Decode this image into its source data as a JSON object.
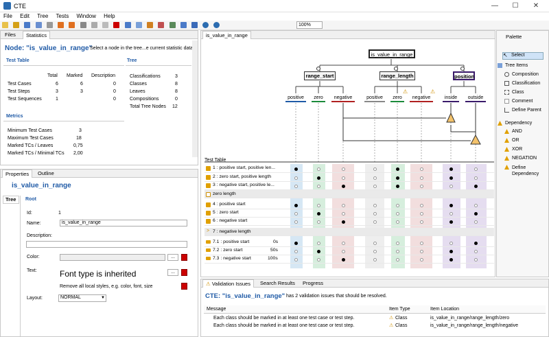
{
  "window": {
    "title": "CTE"
  },
  "menu": [
    "File",
    "Edit",
    "Tree",
    "Tests",
    "Window",
    "Help"
  ],
  "zoom": "100%",
  "left_tabs": {
    "files": "Files",
    "statistics": "Statistics"
  },
  "stats": {
    "node_title": "Node: \"is_value_in_range\"",
    "hint": "Select a node in the tree...e current statistic data.",
    "test_table_header": "Test Table",
    "col_total": "Total",
    "col_marked": "Marked",
    "col_description": "Description",
    "rows": [
      {
        "label": "Test Cases",
        "total": "6",
        "marked": "6",
        "desc": "0"
      },
      {
        "label": "Test Steps",
        "total": "3",
        "marked": "3",
        "desc": "0"
      },
      {
        "label": "Test Sequences",
        "total": "1",
        "marked": "",
        "desc": "0"
      }
    ],
    "tree_header": "Tree",
    "tree_rows": [
      {
        "label": "Classifications",
        "value": "3"
      },
      {
        "label": "Classes",
        "value": "8"
      },
      {
        "label": "Leaves",
        "value": "8"
      },
      {
        "label": "Compositions",
        "value": "0"
      },
      {
        "label": "Total Tree Nodes",
        "value": "12"
      }
    ],
    "metrics_header": "Metrics",
    "metrics": [
      {
        "label": "Minimum Test Cases",
        "value": "3"
      },
      {
        "label": "Maximum Test Cases",
        "value": "18"
      },
      {
        "label": "Marked TCs / Leaves",
        "value": "0,75"
      },
      {
        "label": "Marked TCs / Minimal TCs",
        "value": "2,00"
      }
    ]
  },
  "props": {
    "tabs": {
      "properties": "Properties",
      "outline": "Outline"
    },
    "title": "is_value_in_range",
    "side_tab": "Tree",
    "section": "Root",
    "id_label": "Id:",
    "id_value": "1",
    "name_label": "Name:",
    "name_value": "is_value_in_range",
    "desc_label": "Description:",
    "color_label": "Color:",
    "color_value": "...",
    "text_label": "Text:",
    "font_inherited": "Font type is inherited",
    "remove_styles": "Remove all local styles, e.g. color, font, size",
    "layout_label": "Layout:",
    "layout_value": "NORMAL"
  },
  "editor": {
    "tab": "is_value_in_range",
    "root": "is_value_in_range",
    "classifications": [
      "range_start",
      "range_length",
      "position"
    ],
    "classes": [
      "positive",
      "zero",
      "negative",
      "positive",
      "zero",
      "negative",
      "inside",
      "outside"
    ],
    "test_table_label": "Test Table",
    "rows": [
      {
        "label": "1 : positive start, positive len..."
      },
      {
        "label": "2 : zero start, positive length"
      },
      {
        "label": "3 : negative start, positive le..."
      },
      {
        "label": "zero length"
      },
      {
        "label": "4 : positive start"
      },
      {
        "label": "5 : zero start"
      },
      {
        "label": "6 : negative start"
      },
      {
        "label": "7 : negative length"
      },
      {
        "label": "7.1 : positive start",
        "time": "0s"
      },
      {
        "label": "7.2 : zero start",
        "time": "50s"
      },
      {
        "label": "7.3 : negative start",
        "time": "100s"
      }
    ]
  },
  "palette": {
    "title": "Palette",
    "select": "Select",
    "tree_items_header": "Tree Items",
    "tree_items": [
      "Composition",
      "Classification",
      "Class",
      "Comment",
      "Define Parent"
    ],
    "dependency_header": "Dependency",
    "dependency": [
      "AND",
      "OR",
      "XOR",
      "NEGATION",
      "Define Dependency"
    ]
  },
  "validation": {
    "tabs": {
      "issues": "Validation Issues",
      "search": "Search Results",
      "progress": "Progress"
    },
    "title": "CTE: \"is_value_in_range\"",
    "summary": "has 2 validation issues that should be resolved.",
    "col_message": "Message",
    "col_type": "Item Type",
    "col_location": "Item Location",
    "rows": [
      {
        "message": "Each class should be marked in at least one test case or test step.",
        "type": "Class",
        "location": "is_value_in_range/range_length/zero"
      },
      {
        "message": "Each class should be marked in at least one test case or test step.",
        "type": "Class",
        "location": "is_value_in_range/range_length/negative"
      }
    ]
  }
}
